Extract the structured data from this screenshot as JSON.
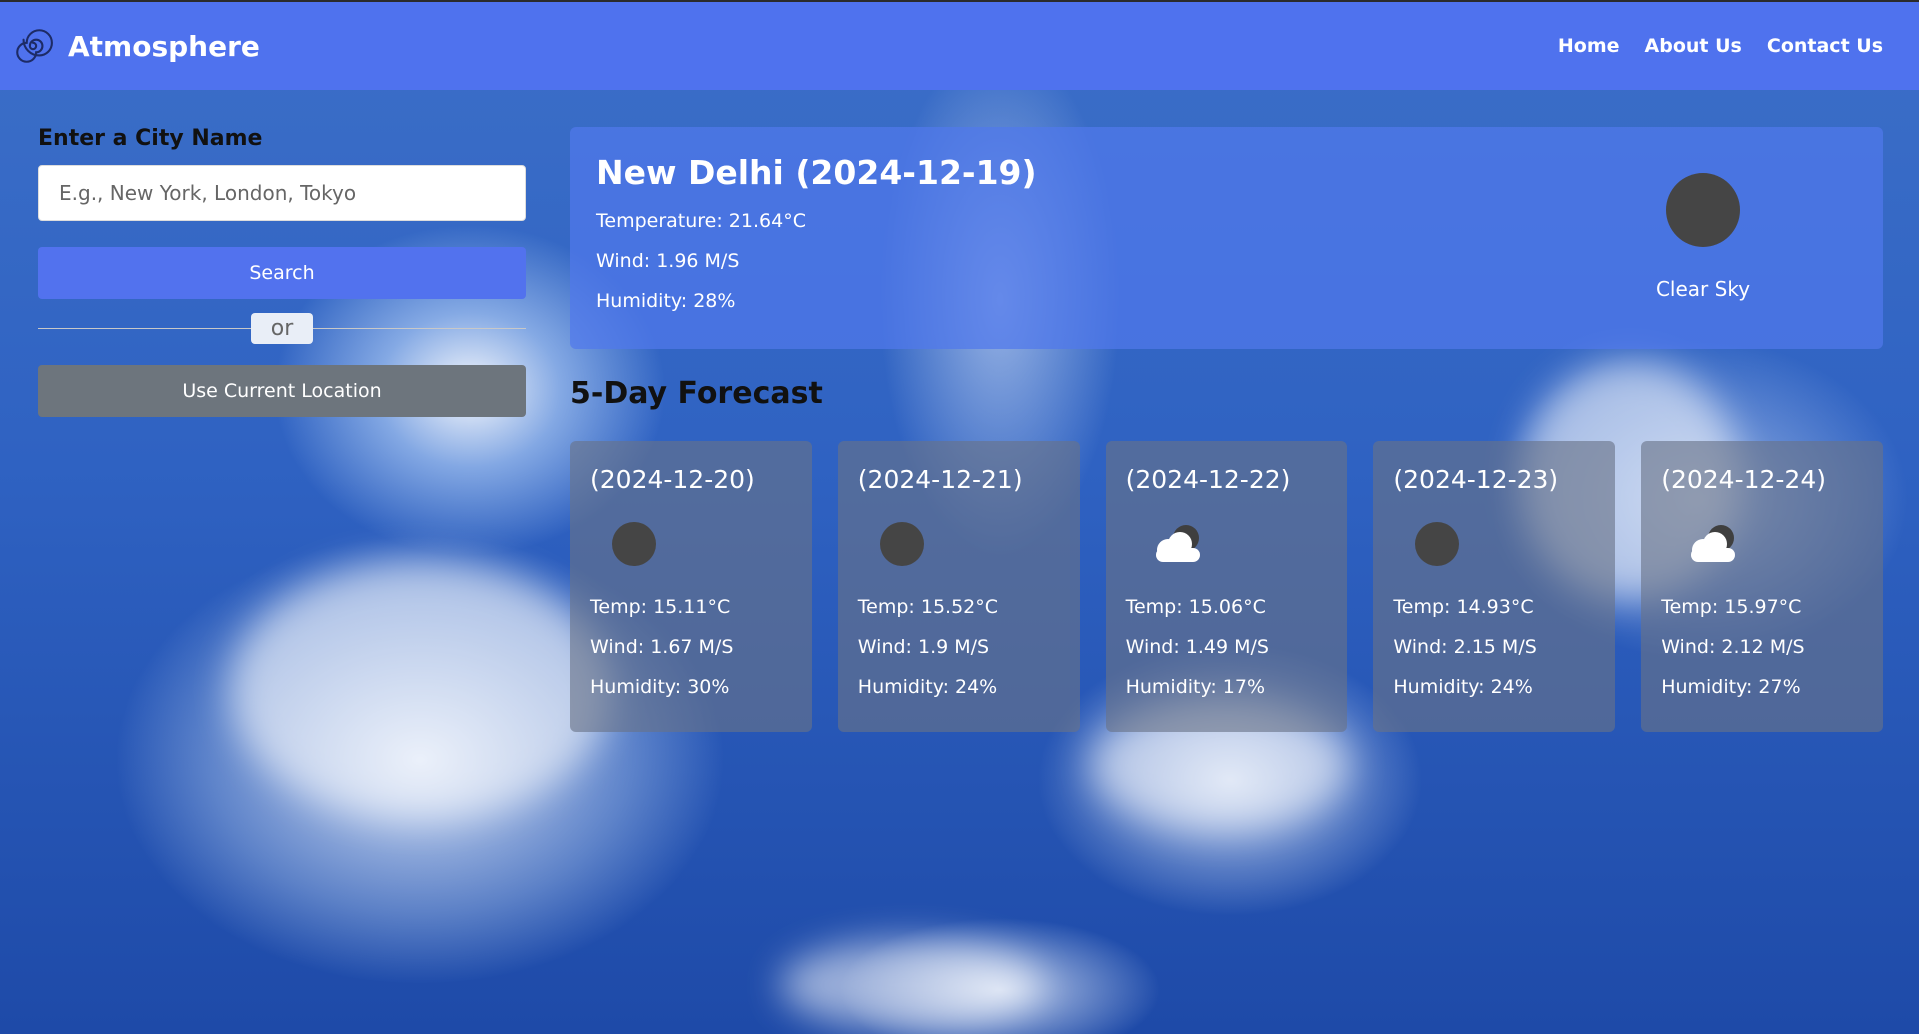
{
  "header": {
    "brand": "Atmosphere",
    "logo_icon": "spiral-icon",
    "nav": [
      "Home",
      "About Us",
      "Contact Us"
    ]
  },
  "search": {
    "label": "Enter a City Name",
    "placeholder": "E.g., New York, London, Tokyo",
    "value": "",
    "search_button": "Search",
    "divider_text": "or",
    "location_button": "Use Current Location"
  },
  "current": {
    "title": "New Delhi (2024-12-19)",
    "temperature": "Temperature: 21.64°C",
    "wind": "Wind: 1.96 M/S",
    "humidity": "Humidity: 28%",
    "icon": "clear-sky-icon",
    "description": "Clear Sky"
  },
  "forecast": {
    "title": "5-Day Forecast",
    "days": [
      {
        "date": "(2024-12-20)",
        "icon": "clear-night-icon",
        "temp": "Temp: 15.11°C",
        "wind": "Wind: 1.67 M/S",
        "humidity": "Humidity: 30%"
      },
      {
        "date": "(2024-12-21)",
        "icon": "clear-night-icon",
        "temp": "Temp: 15.52°C",
        "wind": "Wind: 1.9 M/S",
        "humidity": "Humidity: 24%"
      },
      {
        "date": "(2024-12-22)",
        "icon": "cloudy-night-icon",
        "temp": "Temp: 15.06°C",
        "wind": "Wind: 1.49 M/S",
        "humidity": "Humidity: 17%"
      },
      {
        "date": "(2024-12-23)",
        "icon": "clear-night-icon",
        "temp": "Temp: 14.93°C",
        "wind": "Wind: 2.15 M/S",
        "humidity": "Humidity: 24%"
      },
      {
        "date": "(2024-12-24)",
        "icon": "cloudy-night-icon",
        "temp": "Temp: 15.97°C",
        "wind": "Wind: 2.12 M/S",
        "humidity": "Humidity: 27%"
      }
    ]
  },
  "colors": {
    "navbar": "#4f72ee",
    "primary_button": "#5272ee",
    "secondary_button": "#6d757d"
  }
}
